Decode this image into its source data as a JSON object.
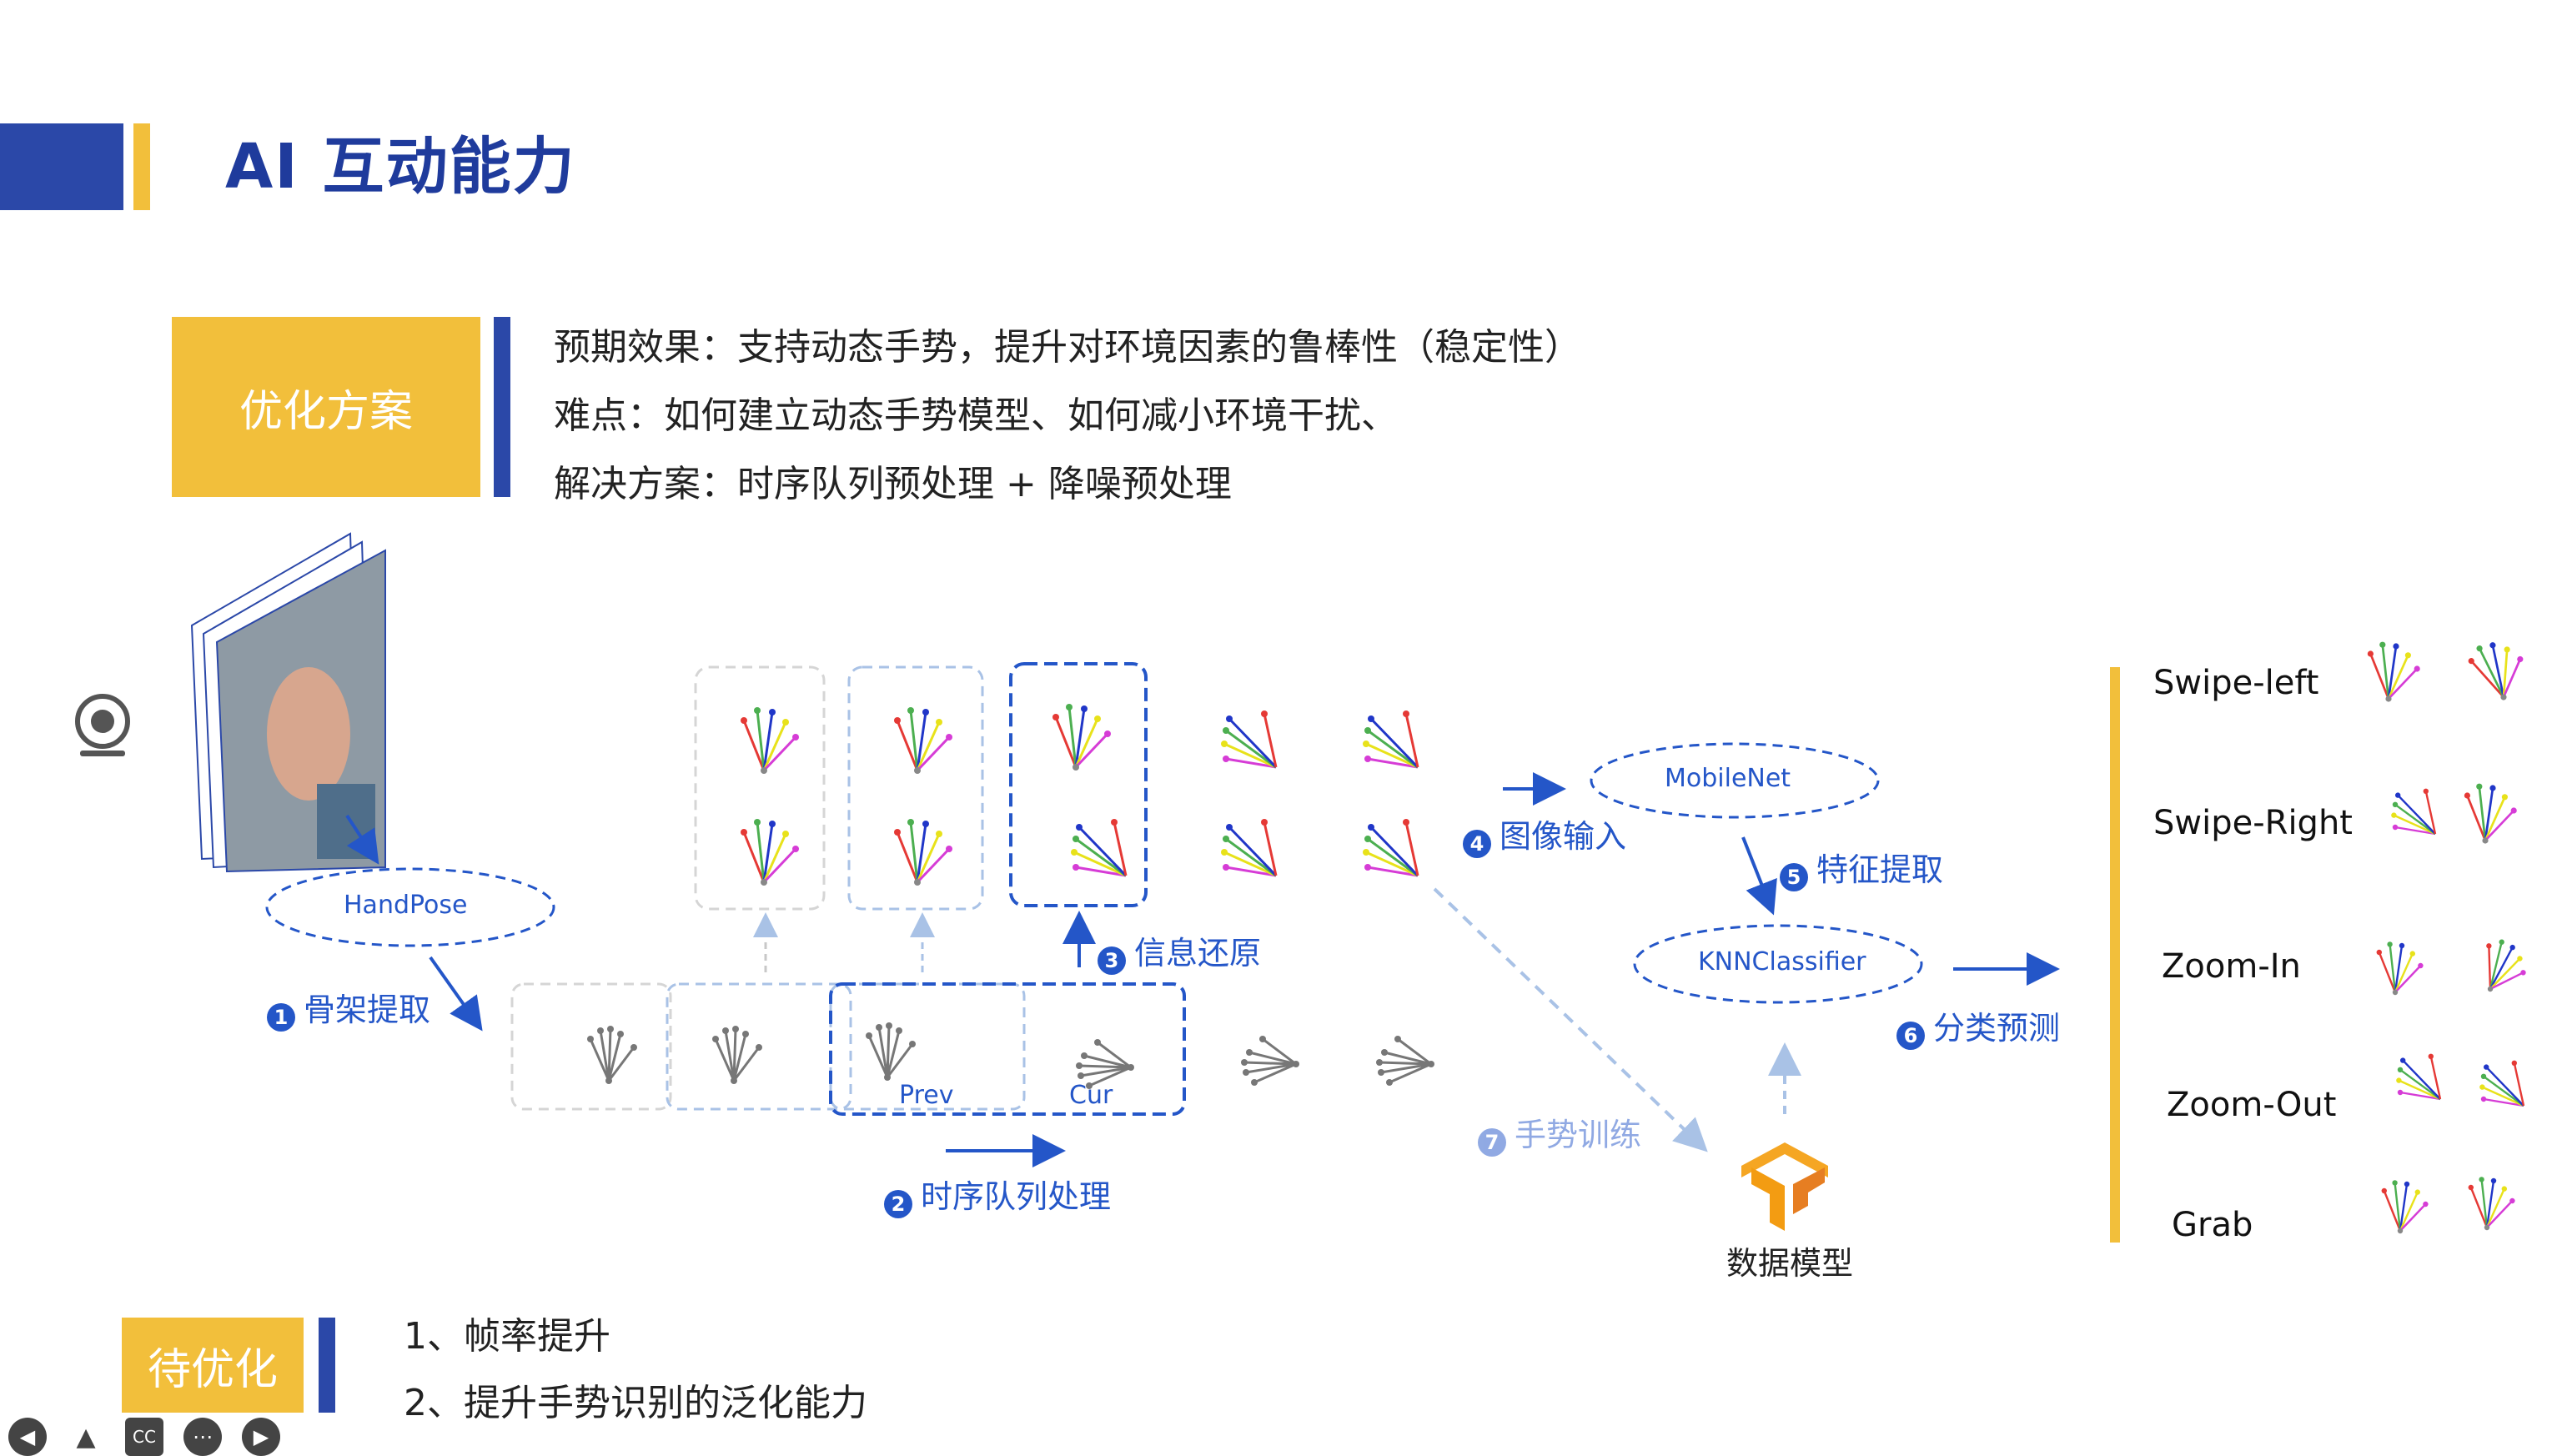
{
  "title": "AI 互动能力",
  "optimize": {
    "badge": "优化方案",
    "lines": [
      "预期效果：支持动态手势，提升对环境因素的鲁棒性（稳定性）",
      "难点：如何建立动态手势模型、如何减小环境干扰、",
      "解决方案：时序队列预处理 + 降噪预处理"
    ]
  },
  "diagram": {
    "handpose": "HandPose",
    "mobilenet": "MobileNet",
    "knn": "KNNClassifier",
    "prev": "Prev",
    "cur": "Cur",
    "model_label": "数据模型",
    "steps": [
      {
        "num": "1",
        "label": "骨架提取"
      },
      {
        "num": "2",
        "label": "时序队列处理"
      },
      {
        "num": "3",
        "label": "信息还原"
      },
      {
        "num": "4",
        "label": "图像输入"
      },
      {
        "num": "5",
        "label": "特征提取"
      },
      {
        "num": "6",
        "label": "分类预测"
      },
      {
        "num": "7",
        "label": "手势训练"
      }
    ]
  },
  "gestures": [
    "Swipe-left",
    "Swipe-Right",
    "Zoom-In",
    "Zoom-Out",
    "Grab"
  ],
  "todo": {
    "badge": "待优化",
    "items": [
      "1、帧率提升",
      "2、提升手势识别的泛化能力"
    ]
  },
  "controls": [
    "prev-icon",
    "pointer-icon",
    "cc-icon",
    "more-icon",
    "next-icon"
  ],
  "colors": {
    "accent_blue": "#2456c8",
    "title_blue": "#1f3b9c",
    "gold": "#f2bf3b",
    "light_blue": "#a9c2e6"
  }
}
